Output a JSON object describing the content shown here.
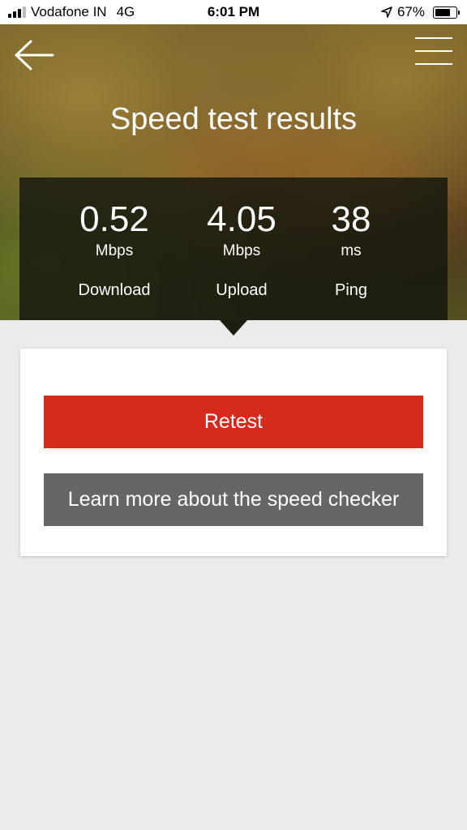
{
  "status_bar": {
    "carrier": "Vodafone IN",
    "network": "4G",
    "time": "6:01 PM",
    "battery": "67%",
    "battery_level": 0.67
  },
  "header": {
    "title": "Speed test results",
    "back_icon": "arrow-left-icon",
    "menu_icon": "hamburger-menu-icon"
  },
  "results": {
    "download": {
      "value": "0.52",
      "unit": "Mbps",
      "label": "Download"
    },
    "upload": {
      "value": "4.05",
      "unit": "Mbps",
      "label": "Upload"
    },
    "ping": {
      "value": "38",
      "unit": "ms",
      "label": "Ping"
    }
  },
  "actions": {
    "retest_label": "Retest",
    "learn_more_label": "Learn more about the speed checker"
  },
  "colors": {
    "retest": "#d52b1e",
    "learn_more": "#666666",
    "background": "#ebebeb"
  }
}
